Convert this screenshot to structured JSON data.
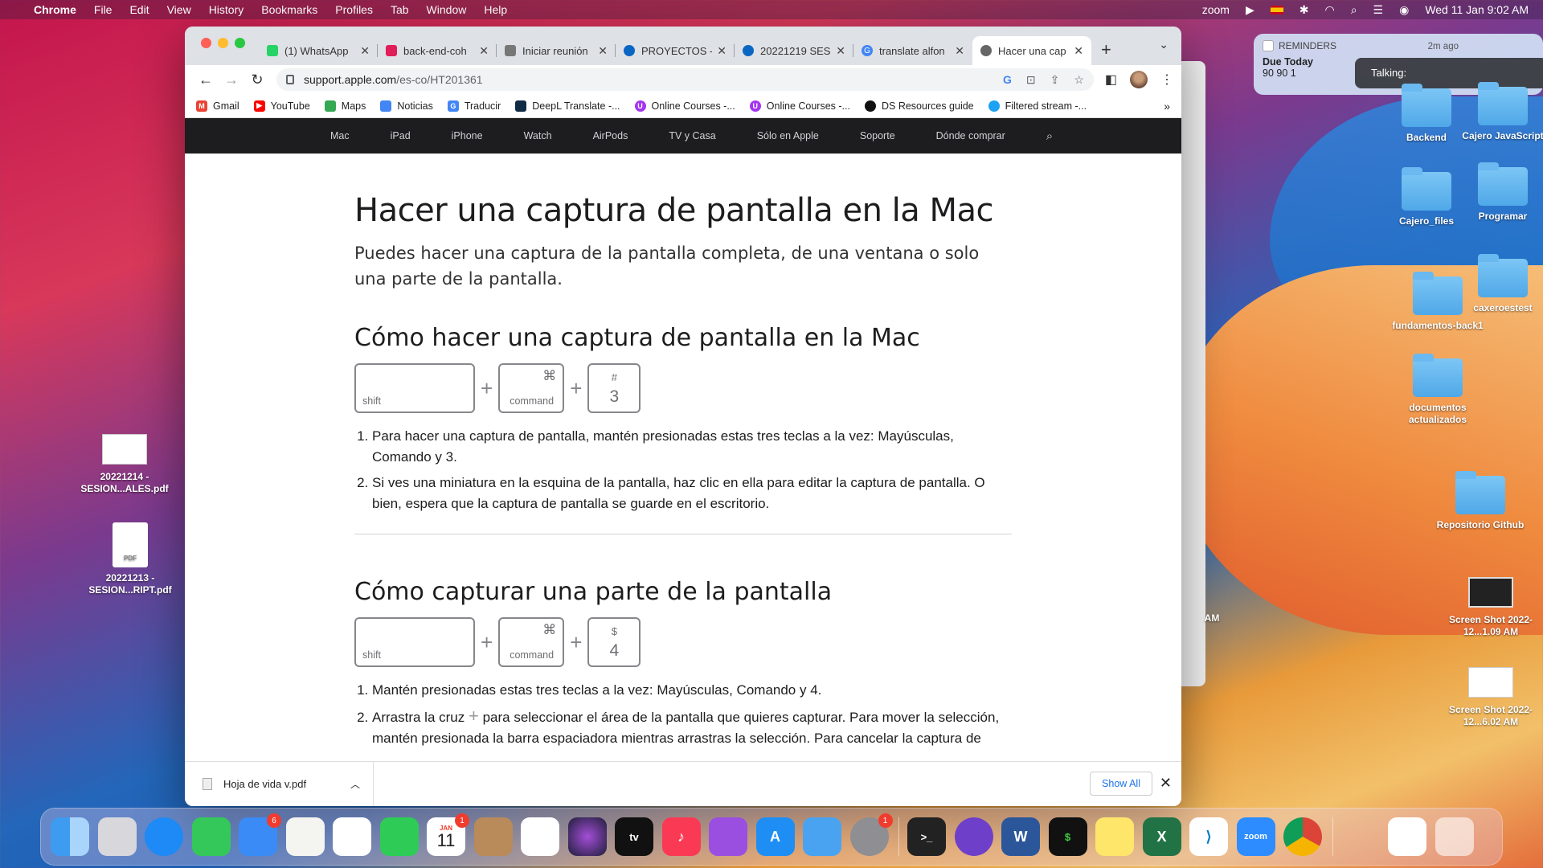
{
  "menubar": {
    "app": "Chrome",
    "items": [
      "File",
      "Edit",
      "View",
      "History",
      "Bookmarks",
      "Profiles",
      "Tab",
      "Window",
      "Help"
    ],
    "zoom": "zoom",
    "datetime": "Wed 11 Jan  9:02 AM"
  },
  "tabs": [
    {
      "title": "(1) WhatsApp",
      "color": "#25d366"
    },
    {
      "title": "back-end-coh",
      "color": "#e01e5a"
    },
    {
      "title": "Iniciar reunión",
      "color": "#555555"
    },
    {
      "title": "PROYECTOS -",
      "color": "#0a66c2"
    },
    {
      "title": "20221219 SES",
      "color": "#0a66c2"
    },
    {
      "title": "translate alfon",
      "color": "#4285f4"
    },
    {
      "title": "Hacer una cap",
      "color": "#555555"
    }
  ],
  "toolbar": {
    "url_host": "support.apple.com",
    "url_path": "/es-co/HT201361"
  },
  "bookmarks": [
    {
      "label": "Gmail",
      "color": "#ea4335"
    },
    {
      "label": "YouTube",
      "color": "#ff0000"
    },
    {
      "label": "Maps",
      "color": "#34a853"
    },
    {
      "label": "Noticias",
      "color": "#4285f4"
    },
    {
      "label": "Traducir",
      "color": "#4285f4"
    },
    {
      "label": "DeepL Translate -...",
      "color": "#0f2b46"
    },
    {
      "label": "Online Courses -...",
      "color": "#a435f0"
    },
    {
      "label": "Online Courses -...",
      "color": "#a435f0"
    },
    {
      "label": "DS Resources guide",
      "color": "#111111"
    },
    {
      "label": "Filtered stream -...",
      "color": "#1da1f2"
    }
  ],
  "apple_nav": [
    "Mac",
    "iPad",
    "iPhone",
    "Watch",
    "AirPods",
    "TV y Casa",
    "Sólo en Apple",
    "Soporte",
    "Dónde comprar"
  ],
  "article": {
    "title": "Hacer una captura de pantalla en la Mac",
    "lead": "Puedes hacer una captura de la pantalla completa, de una ventana o solo una parte de la pantalla.",
    "section1": {
      "heading": "Cómo hacer una captura de pantalla en la Mac",
      "keys": {
        "shift": "shift",
        "cmd_symbol": "⌘",
        "command": "command",
        "top": "#",
        "num": "3"
      },
      "steps": [
        "Para hacer una captura de pantalla, mantén presionadas estas tres teclas a la vez: Mayúsculas, Comando y 3.",
        "Si ves una miniatura en la esquina de la pantalla, haz clic en ella para editar la captura de pantalla. O bien, espera que la captura de pantalla se guarde en el escritorio."
      ]
    },
    "section2": {
      "heading": "Cómo capturar una parte de la pantalla",
      "keys": {
        "shift": "shift",
        "cmd_symbol": "⌘",
        "command": "command",
        "top": "$",
        "num": "4"
      },
      "step1": "Mantén presionadas estas tres teclas a la vez: Mayúsculas, Comando y 4.",
      "step2_a": "Arrastra la cruz",
      "step2_b": "para seleccionar el área de la pantalla que quieres capturar. Para mover la selección, mantén presionada la barra espaciadora mientras arrastras la selección. Para cancelar la captura de"
    }
  },
  "download": {
    "file": "Hoja de vida v.pdf",
    "show_all": "Show All"
  },
  "notification": {
    "app": "REMINDERS",
    "time": "2m ago",
    "title": "Due Today",
    "body": "90 90 1",
    "talking": "Talking:"
  },
  "desktop": {
    "folders": [
      {
        "label": "Backend"
      },
      {
        "label": "Cajero JavaScript"
      },
      {
        "label": "Cajero_files"
      },
      {
        "label": "Programar"
      },
      {
        "label": "fundamentos-back1"
      },
      {
        "label": "caxeroestest"
      },
      {
        "label": "documentos actualizados"
      },
      {
        "label": "Repositorio Github"
      }
    ],
    "files": [
      {
        "label": "20221214 - SESION...ALES.pdf"
      },
      {
        "label": "20221213 - SESION...RIPT.pdf"
      },
      {
        "label": "Screen Shot 2022-12...1.09 AM"
      },
      {
        "label": "Screen Shot 2022-12...6.02 AM"
      }
    ],
    "partial_text": "AM"
  },
  "dock": {
    "mail_badge": "6",
    "calendar_month": "JAN",
    "calendar_day": "11",
    "calendar_badge": "1",
    "settings_badge": "1",
    "zoom": "zoom"
  }
}
